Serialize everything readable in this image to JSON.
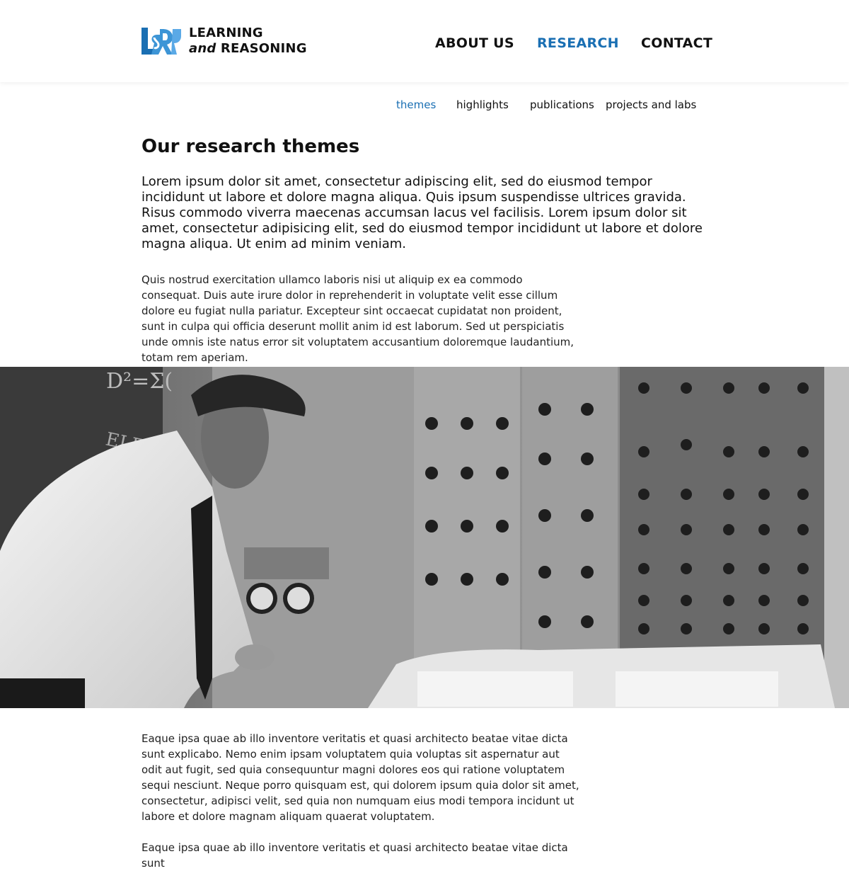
{
  "brand": {
    "line1": "LEARNING",
    "line2_italic": "and",
    "line2_rest": "REASONING",
    "accent_color": "#1a6fb3",
    "logo_icon": "l-and-r-logo-icon"
  },
  "main_nav": [
    {
      "label": "ABOUT US",
      "active": false
    },
    {
      "label": "RESEARCH",
      "active": true
    },
    {
      "label": "CONTACT",
      "active": false
    }
  ],
  "sub_nav": [
    {
      "label": "themes",
      "active": true
    },
    {
      "label": "highlights",
      "active": false
    },
    {
      "label": "publications",
      "active": false
    },
    {
      "label": "projects and labs",
      "active": false
    }
  ],
  "page": {
    "title": "Our research themes",
    "lead": "Lorem ipsum dolor sit amet, consectetur adipiscing elit, sed do eiusmod tempor incididunt ut labore et dolore magna aliqua. Quis ipsum suspendisse ultrices gravida. Risus commodo viverra maecenas accumsan lacus vel facilisis. Lorem ipsum dolor sit amet, consectetur adipisicing elit, sed do eiusmod tempor incididunt ut labore et dolore magna aliqua. Ut enim ad minim veniam.",
    "paragraph1": "Quis nostrud exercitation ullamco laboris nisi ut aliquip ex ea commodo consequat. Duis aute irure dolor in reprehenderit in voluptate velit esse cillum dolore eu fugiat nulla pariatur. Excepteur sint occaecat cupidatat non proident, sunt in culpa qui officia deserunt mollit anim id est laborum. Sed ut perspiciatis unde omnis iste natus error sit voluptatem accusantium doloremque laudantium, totam rem aperiam.",
    "paragraph2": "Eaque ipsa quae ab illo inventore veritatis et quasi architecto beatae vitae dicta sunt explicabo. Nemo enim ipsam voluptatem quia voluptas sit aspernatur aut odit aut fugit, sed quia consequuntur magni dolores eos qui ratione voluptatem sequi nesciunt. Neque porro quisquam est, qui dolorem ipsum quia dolor sit amet, consectetur, adipisci velit, sed quia non numquam eius modi tempora incidunt ut labore et dolore magnam aliquam quaerat voluptatem.",
    "paragraph3": "Eaque ipsa quae ab illo inventore veritatis et quasi architecto beatae vitae dicta sunt"
  },
  "hero": {
    "subject": "black-and-white photo of a man operating a vintage computer control panel",
    "chalkboard_text": "D² = Σ(  ELEC"
  }
}
